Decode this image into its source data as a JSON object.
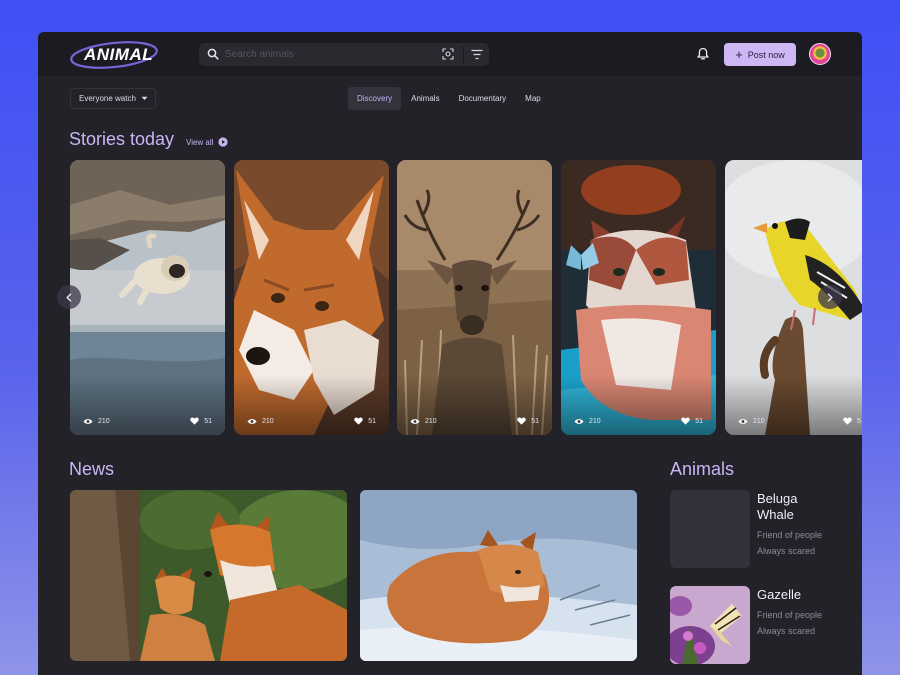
{
  "header": {
    "logo_text": "ANIMAL",
    "search_placeholder": "Search animals",
    "post_label": "Post now"
  },
  "filters": {
    "watch_select": "Everyone watch",
    "tabs": [
      {
        "label": "Discovery",
        "active": true
      },
      {
        "label": "Animals",
        "active": false
      },
      {
        "label": "Documentary",
        "active": false
      },
      {
        "label": "Map",
        "active": false
      }
    ]
  },
  "stories": {
    "title": "Stories today",
    "view_all": "View all",
    "items": [
      {
        "subject": "pug",
        "views": "210",
        "likes": "51"
      },
      {
        "subject": "fox",
        "views": "210",
        "likes": "51"
      },
      {
        "subject": "deer",
        "views": "210",
        "likes": "51"
      },
      {
        "subject": "cat",
        "views": "210",
        "likes": "51"
      },
      {
        "subject": "bird",
        "views": "210",
        "likes": "5"
      }
    ]
  },
  "news": {
    "title": "News"
  },
  "animals": {
    "title": "Animals",
    "items": [
      {
        "name": "Beluga Whale",
        "line1": "Friend of people",
        "line2": "Always scared"
      },
      {
        "name": "Gazelle",
        "line1": "Friend of people",
        "line2": "Always scared"
      }
    ]
  },
  "colors": {
    "accent": "#c9b6f5",
    "button": "#cfb7f5",
    "panel": "#232229",
    "topbar": "#1c1b21"
  }
}
